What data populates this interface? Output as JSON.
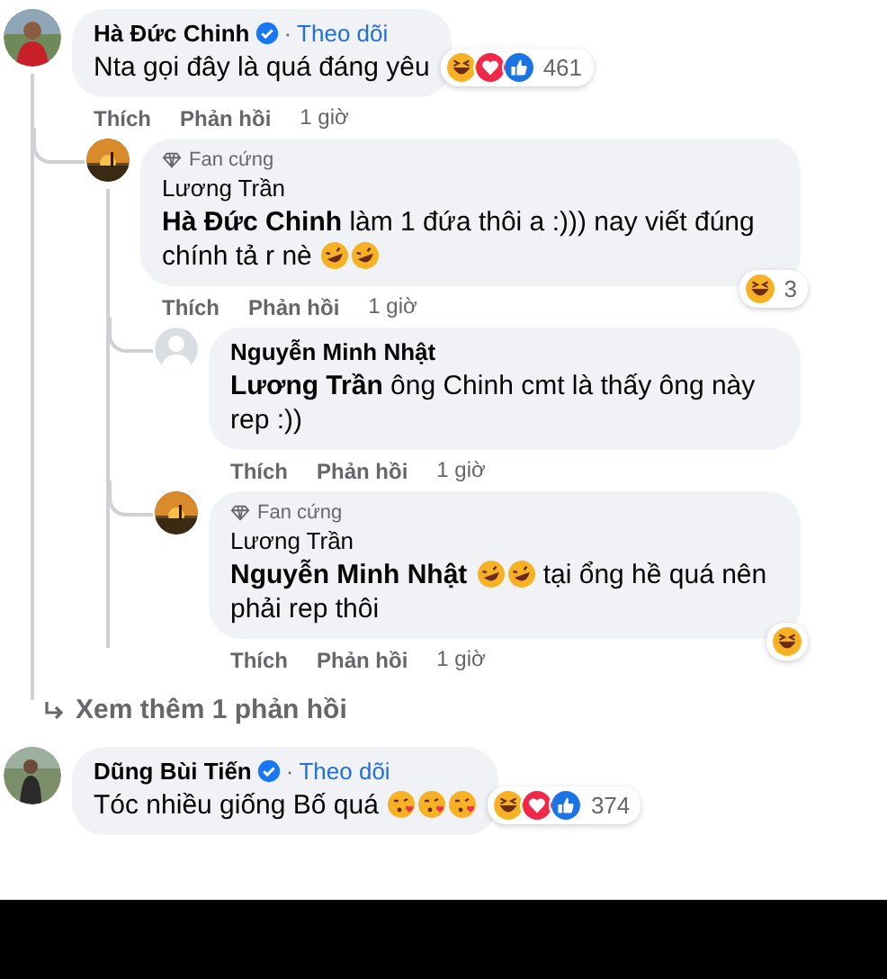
{
  "comments": [
    {
      "avatar": {
        "kind": "portrait"
      },
      "name": "Hà Đức Chinh",
      "verified": true,
      "separator": "·",
      "follow": "Theo dõi",
      "body": [
        {
          "kind": "text",
          "text": "Nta gọi đây là quá đáng yêu"
        }
      ],
      "reactions": [
        {
          "kind": "haha"
        },
        {
          "kind": "love"
        },
        {
          "kind": "like"
        }
      ],
      "reaction_count": "461",
      "actions": {
        "like": "Thích",
        "reply": "Phản hồi",
        "time": "1 giờ"
      },
      "replies": [
        {
          "avatar": {
            "kind": "sunset"
          },
          "badge": "Fan cứng",
          "name": "Lương Trần",
          "body": [
            {
              "kind": "mention",
              "text": "Hà Đức Chinh"
            },
            {
              "kind": "text",
              "text": " làm 1 đứa thôi a :))) nay viết đúng chính tả r nè"
            },
            {
              "kind": "rofl"
            },
            {
              "kind": "rofl"
            }
          ],
          "reactions": [
            {
              "kind": "haha"
            }
          ],
          "reaction_count": "3",
          "actions": {
            "like": "Thích",
            "reply": "Phản hồi",
            "time": "1 giờ"
          },
          "replies": [
            {
              "avatar": {
                "kind": "blank"
              },
              "name": "Nguyễn Minh Nhật",
              "body": [
                {
                  "kind": "mention",
                  "text": "Lương Trần"
                },
                {
                  "kind": "text",
                  "text": " ông Chinh cmt là thấy ông này rep :))"
                }
              ],
              "actions": {
                "like": "Thích",
                "reply": "Phản hồi",
                "time": "1 giờ"
              }
            },
            {
              "avatar": {
                "kind": "sunset"
              },
              "badge": "Fan cứng",
              "name": "Lương Trần",
              "body": [
                {
                  "kind": "mention",
                  "text": "Nguyễn Minh Nhật"
                },
                {
                  "kind": "rofl"
                },
                {
                  "kind": "rofl"
                },
                {
                  "kind": "text",
                  "text": " tại ổng hề quá nên phải rep thôi"
                }
              ],
              "reactions": [
                {
                  "kind": "haha"
                }
              ],
              "actions": {
                "like": "Thích",
                "reply": "Phản hồi",
                "time": "1 giờ"
              }
            }
          ]
        }
      ],
      "more_replies": "Xem thêm 1 phản hồi"
    },
    {
      "avatar": {
        "kind": "keeper"
      },
      "name": "Dũng Bùi Tiến",
      "verified": true,
      "separator": "·",
      "follow": "Theo dõi",
      "body": [
        {
          "kind": "text",
          "text": "Tóc nhiều giống Bố quá"
        },
        {
          "kind": "kiss"
        },
        {
          "kind": "kiss"
        },
        {
          "kind": "kiss"
        }
      ],
      "reactions": [
        {
          "kind": "haha"
        },
        {
          "kind": "love"
        },
        {
          "kind": "like"
        }
      ],
      "reaction_count": "374"
    }
  ]
}
